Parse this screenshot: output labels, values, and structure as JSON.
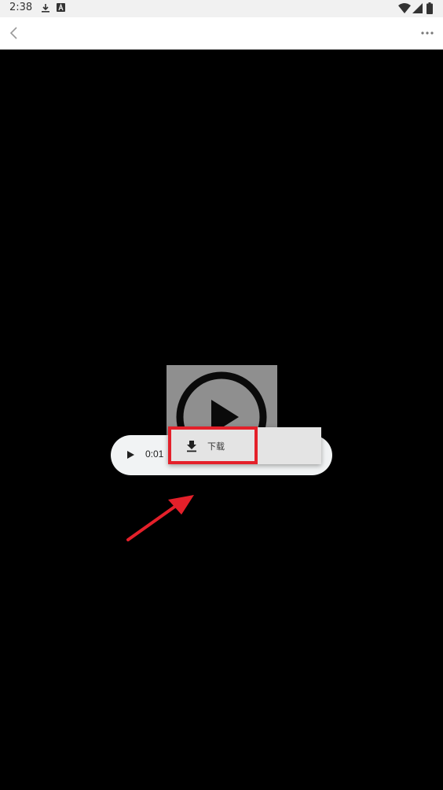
{
  "status_bar": {
    "time": "2:38"
  },
  "nav": {
    "back_icon": "chevron-left-icon",
    "more_icon": "more-horizontal-icon"
  },
  "audio_player": {
    "time": "0:01"
  },
  "context_menu": {
    "items": [
      {
        "label": "下载",
        "icon": "download-icon"
      }
    ]
  },
  "colors": {
    "highlight": "#e4202a",
    "background": "#000000",
    "thumbnail": "#8f8f8f"
  }
}
